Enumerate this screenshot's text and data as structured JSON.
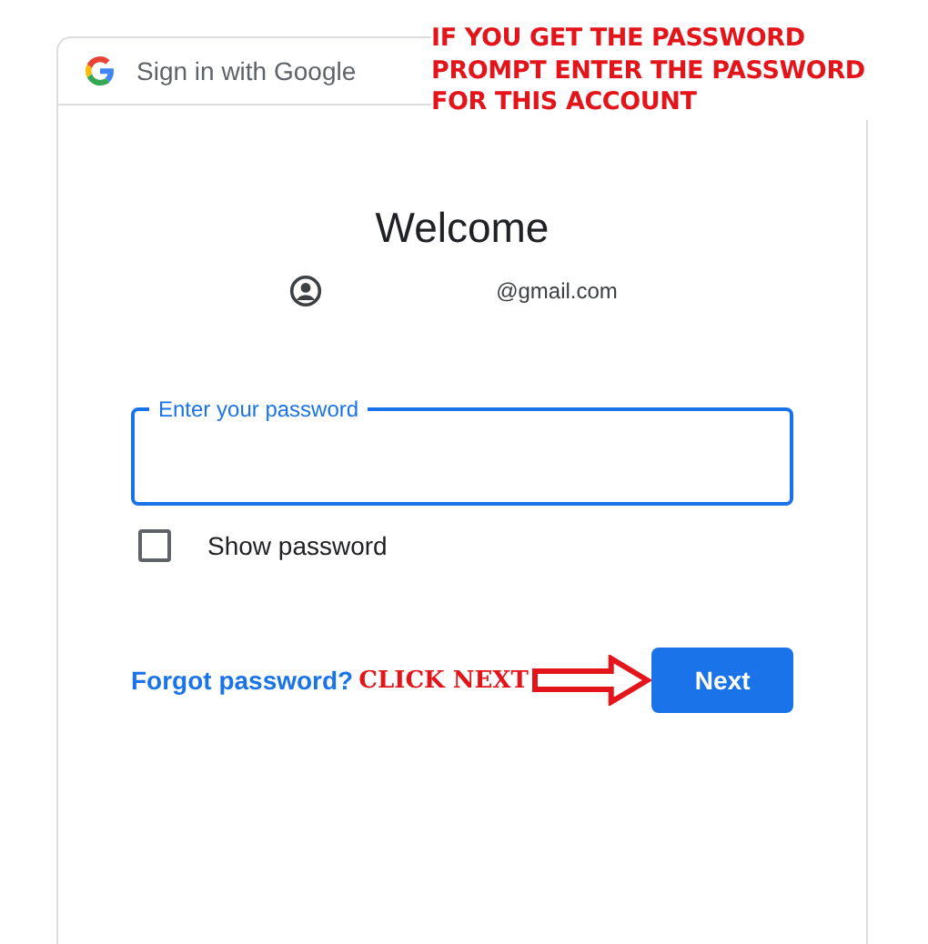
{
  "header": {
    "title": "Sign in with Google"
  },
  "heading": "Welcome",
  "account": {
    "email": "@gmail.com"
  },
  "password_field": {
    "label": "Enter your password",
    "focused": true
  },
  "show_password": {
    "label": "Show password",
    "checked": false
  },
  "forgot_link": "Forgot password?",
  "next_button": "Next",
  "annotations": [
    {
      "kind": "note",
      "text": "IF YOU GET THE PASSWORD PROMPT ENTER THE PASSWORD FOR THIS ACCOUNT"
    },
    {
      "kind": "callout",
      "text": "CLICK NEXT"
    }
  ]
}
